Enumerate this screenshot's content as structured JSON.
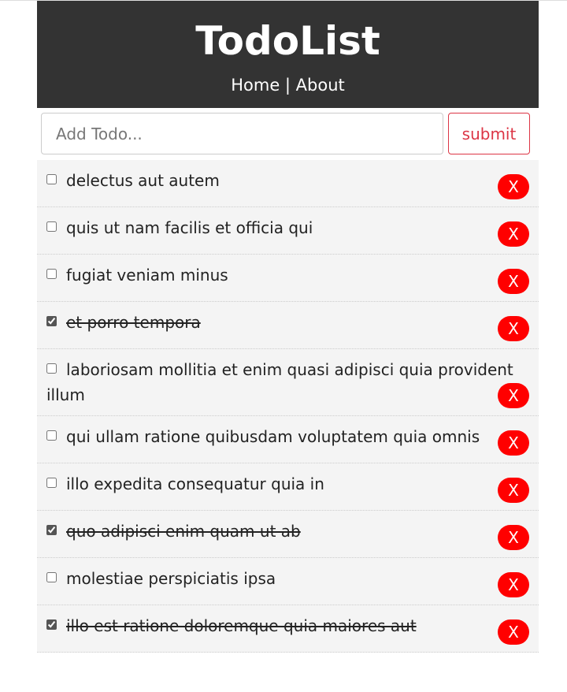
{
  "header": {
    "title": "TodoList",
    "nav_home": "Home",
    "nav_sep": " | ",
    "nav_about": "About"
  },
  "form": {
    "placeholder": "Add Todo...",
    "submit_label": "submit"
  },
  "todos": [
    {
      "title": "delectus aut autem",
      "completed": false,
      "delete_label": "X"
    },
    {
      "title": "quis ut nam facilis et officia qui",
      "completed": false,
      "delete_label": "X"
    },
    {
      "title": "fugiat veniam minus",
      "completed": false,
      "delete_label": "X"
    },
    {
      "title": "et porro tempora",
      "completed": true,
      "delete_label": "X"
    },
    {
      "title": "laboriosam mollitia et enim quasi adipisci quia provident illum",
      "completed": false,
      "delete_label": "X"
    },
    {
      "title": "qui ullam ratione quibusdam voluptatem quia omnis",
      "completed": false,
      "delete_label": "X"
    },
    {
      "title": "illo expedita consequatur quia in",
      "completed": false,
      "delete_label": "X"
    },
    {
      "title": "quo adipisci enim quam ut ab",
      "completed": true,
      "delete_label": "X"
    },
    {
      "title": "molestiae perspiciatis ipsa",
      "completed": false,
      "delete_label": "X"
    },
    {
      "title": "illo est ratione doloremque quia maiores aut",
      "completed": true,
      "delete_label": "X"
    }
  ],
  "colors": {
    "header_bg": "#333333",
    "delete_button": "#ff0000",
    "submit_border": "#dc3545",
    "item_bg": "#f4f4f4"
  }
}
